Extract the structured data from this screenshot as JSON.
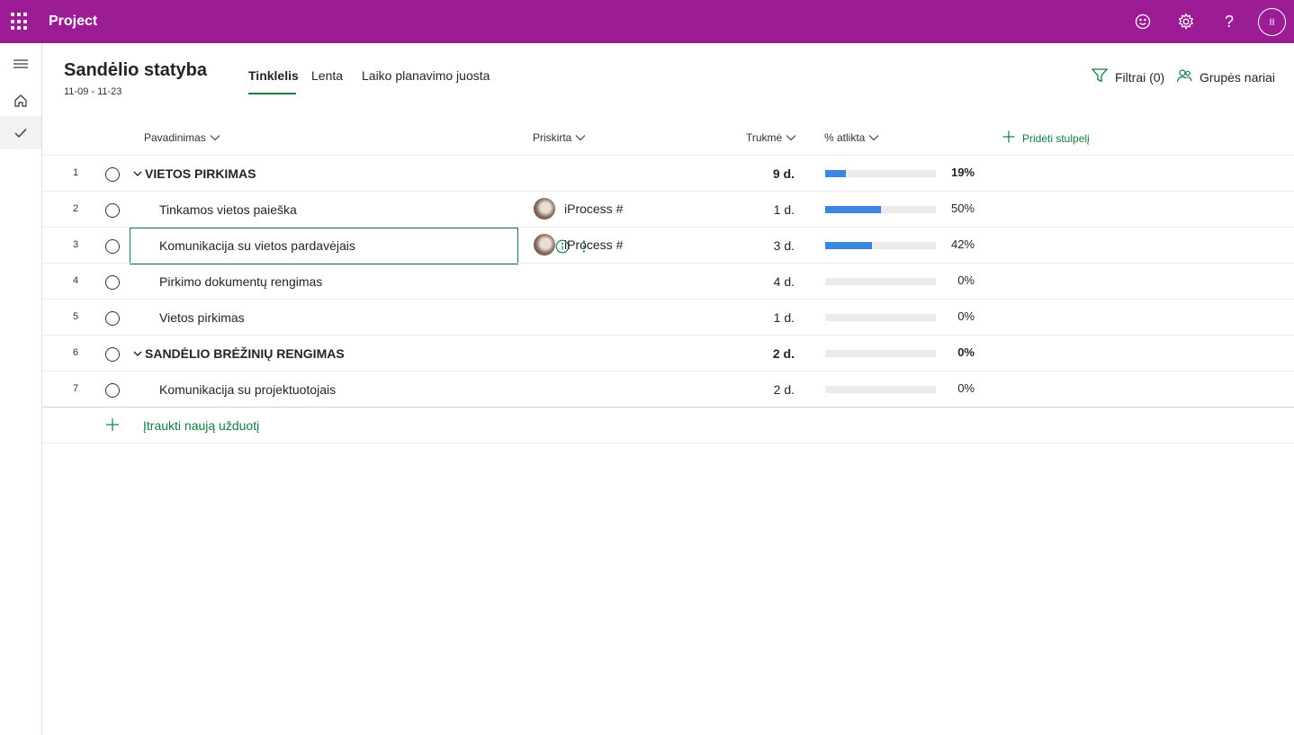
{
  "app": {
    "title": "Project"
  },
  "topbar": {
    "icons": [
      "smiley-icon",
      "gear-icon",
      "help-icon"
    ],
    "user_initials": "II"
  },
  "rail": {
    "items": [
      "menu-icon",
      "home-icon",
      "check-icon"
    ]
  },
  "plan": {
    "title": "Sandėlio statyba",
    "dates": "11-09 - 11-23"
  },
  "tabs": [
    {
      "label": "Tinklelis",
      "active": true
    },
    {
      "label": "Lenta",
      "active": false
    },
    {
      "label": "Laiko planavimo juosta",
      "active": false
    }
  ],
  "actions": {
    "filters": "Filtrai (0)",
    "members": "Grupės nariai"
  },
  "columns": {
    "name": "Pavadinimas",
    "assigned": "Priskirta",
    "duration": "Trukmė",
    "percent": "% atlikta",
    "add_column": "Pridėti stulpelį"
  },
  "tasks": [
    {
      "num": "1",
      "name": "VIETOS PIRKIMAS",
      "group": true,
      "assignee": "",
      "duration": "9 d.",
      "percent_label": "19%",
      "percent": 19
    },
    {
      "num": "2",
      "name": "Tinkamos vietos paieška",
      "group": false,
      "assignee": "iProcess #",
      "duration": "1 d.",
      "percent_label": "50%",
      "percent": 50
    },
    {
      "num": "3",
      "name": "Komunikacija su vietos pardavėjais",
      "group": false,
      "assignee": "iProcess #",
      "duration": "3 d.",
      "percent_label": "42%",
      "percent": 42,
      "selected": true
    },
    {
      "num": "4",
      "name": "Pirkimo dokumentų rengimas",
      "group": false,
      "assignee": "",
      "duration": "4 d.",
      "percent_label": "0%",
      "percent": 0
    },
    {
      "num": "5",
      "name": "Vietos pirkimas",
      "group": false,
      "assignee": "",
      "duration": "1 d.",
      "percent_label": "0%",
      "percent": 0
    },
    {
      "num": "6",
      "name": "SANDĖLIO BRĖŽINIŲ RENGIMAS",
      "group": true,
      "assignee": "",
      "duration": "2 d.",
      "percent_label": "0%",
      "percent": 0
    },
    {
      "num": "7",
      "name": "Komunikacija su projektuotojais",
      "group": false,
      "assignee": "",
      "duration": "2 d.",
      "percent_label": "0%",
      "percent": 0
    }
  ],
  "add_task": {
    "label": "Įtraukti naują užduotį"
  },
  "colors": {
    "suite_bar": "#9c1c96",
    "accent": "#107c41",
    "progress": "#3a86e0"
  }
}
